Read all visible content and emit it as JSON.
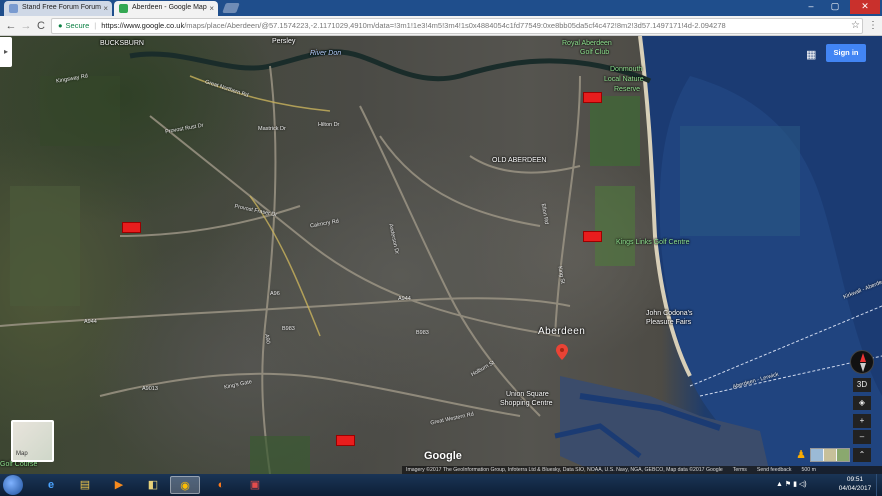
{
  "browser": {
    "tabs": [
      {
        "title": "Stand Free Forum Forum",
        "favicon_color": "#7a9bd0",
        "active": false
      },
      {
        "title": "Aberdeen - Google Map",
        "favicon_color": "#34a853",
        "active": true
      }
    ],
    "close_glyph": "×",
    "window_controls": {
      "minimize": "–",
      "maximize": "▢",
      "close": "✕"
    },
    "nav": {
      "back": "←",
      "forward": "→",
      "reload": "C"
    },
    "omnibox": {
      "secure_label": "Secure",
      "url_main": "https://www.google.co.uk",
      "url_rest": "/maps/place/Aberdeen/@57.1574223,-2.1171029,4910m/data=!3m1!1e3!4m5!3m4!1s0x4884054c1fd77549:0xe8bb05da5cf4c472!8m2!3d57.1497171!4d-2.094278"
    },
    "star_glyph": "☆",
    "menu_glyph": "⋮"
  },
  "map": {
    "side_panel_glyph": "▸",
    "sign_in_label": "Sign in",
    "apps_glyph": "▦",
    "logo": "Google",
    "minimap_label": "Map",
    "controls": {
      "tilt_3d": "3D",
      "locate": "◈",
      "zoom_in": "+",
      "zoom_out": "–",
      "expand": "⌃"
    },
    "pegman_glyph": "♟",
    "places": [
      {
        "name": "BUCKSBURN"
      },
      {
        "name": "Persley"
      },
      {
        "name": "River Don"
      },
      {
        "name": "Royal Aberdeen"
      },
      {
        "name": "Golf Club"
      },
      {
        "name": "Donmouth"
      },
      {
        "name": "Local Nature"
      },
      {
        "name": "Reserve"
      },
      {
        "name": "Hilton Dr"
      },
      {
        "name": "OLD ABERDEEN"
      },
      {
        "name": "Kings Links Golf Centre"
      },
      {
        "name": "John Codona's"
      },
      {
        "name": "Pleasure Fairs"
      },
      {
        "name": "Aberdeen"
      },
      {
        "name": "Union Square"
      },
      {
        "name": "Shopping Centre"
      },
      {
        "name": "Golf Course"
      }
    ],
    "roads": [
      {
        "name": "Provost Rust Dr"
      },
      {
        "name": "Provost Fraser Dr"
      },
      {
        "name": "Cairncry Rd"
      },
      {
        "name": "A96"
      },
      {
        "name": "A944"
      },
      {
        "name": "A944"
      },
      {
        "name": "A90"
      },
      {
        "name": "B983"
      },
      {
        "name": "B983"
      },
      {
        "name": "King's Gate"
      },
      {
        "name": "A9013"
      },
      {
        "name": "Kirkwall - Aberdeen"
      },
      {
        "name": "Aberdeen - Lerwick"
      },
      {
        "name": "Great Northern Rd"
      },
      {
        "name": "Mastrick Dr"
      },
      {
        "name": "Anderson Dr"
      },
      {
        "name": "Great Western Rd"
      },
      {
        "name": "Ellon Rd"
      },
      {
        "name": "Kingsway Rd"
      },
      {
        "name": "King St"
      },
      {
        "name": "Holburn St"
      }
    ],
    "attribution": {
      "imagery": "Imagery ©2017 The GeoInformation Group, Infoterra Ltd & Bluesky, Data SIO, NOAA, U.S. Navy, NGA, GEBCO, Map data ©2017 Google",
      "terms": "Terms",
      "feedback": "Send feedback",
      "scale": "500 m"
    },
    "marker_color": "#e81d1d"
  },
  "taskbar": {
    "icons": [
      {
        "name": "ie-icon",
        "glyph": "e"
      },
      {
        "name": "explorer-icon",
        "glyph": "▤"
      },
      {
        "name": "media-player-icon",
        "glyph": "▶"
      },
      {
        "name": "app-icon",
        "glyph": "◧"
      },
      {
        "name": "chrome-icon",
        "glyph": "◉"
      },
      {
        "name": "firefox-icon",
        "glyph": "◐"
      },
      {
        "name": "paint-icon",
        "glyph": "▣"
      }
    ],
    "tray_glyphs": "▲ ⚑ ▮ ◁)",
    "time": "09:51",
    "date": "04/04/2017"
  }
}
